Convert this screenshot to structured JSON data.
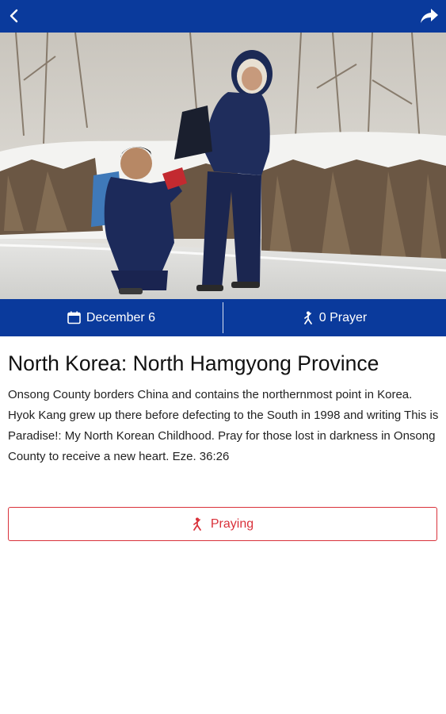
{
  "topbar": {
    "back_icon": "chevron-left-icon",
    "share_icon": "share-arrow-icon",
    "color": "#0a3a9c"
  },
  "hero": {
    "image": "two children in winter coats on an icy snowy path"
  },
  "info": {
    "date_icon": "calendar-icon",
    "date": "December 6",
    "prayer_icon": "praying-person-icon",
    "prayer_count": "0 Prayer"
  },
  "content": {
    "title": "North Korea: North Hamgyong Province",
    "body": "Onsong County borders China and contains the northernmost point in Korea. Hyok Kang grew up there before defecting to the South in 1998 and writing This is Paradise!: My North Korean Childhood. Pray for those lost in darkness in Onsong County to receive a new heart. Eze. 36:26"
  },
  "action": {
    "icon": "praying-person-icon",
    "label": "Praying",
    "color": "#d9313a"
  }
}
